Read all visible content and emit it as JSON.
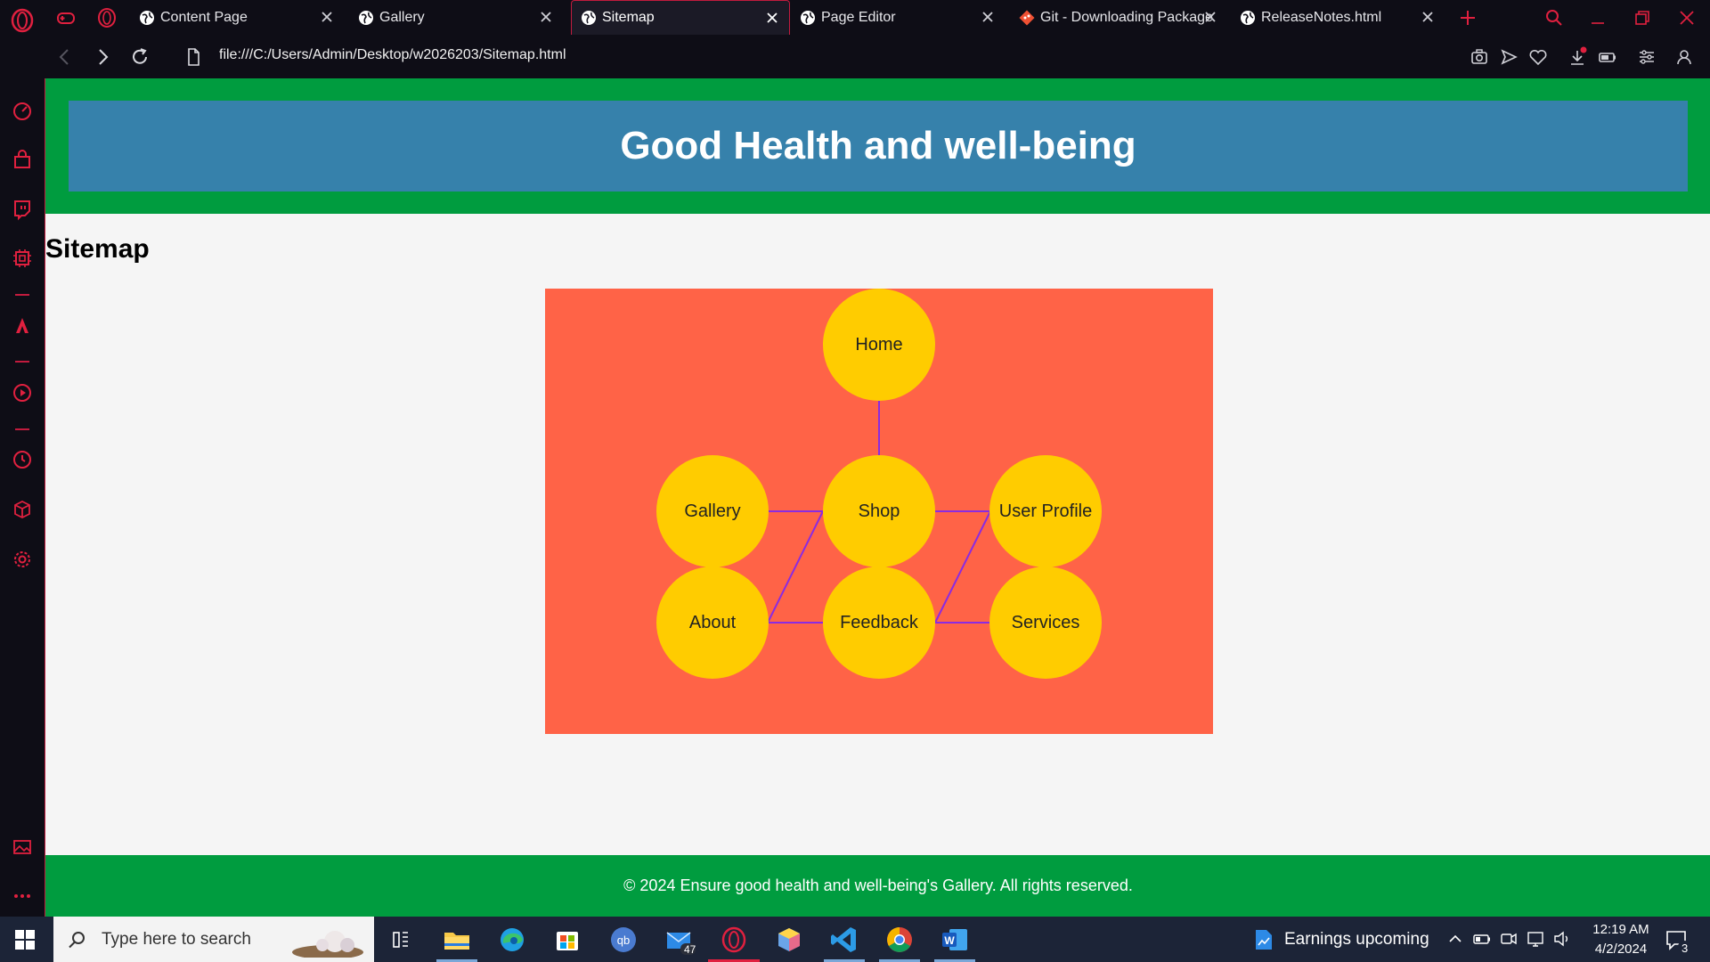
{
  "browser": {
    "tabs": [
      {
        "label": "Content Page",
        "active": false
      },
      {
        "label": "Gallery",
        "active": false
      },
      {
        "label": "Sitemap",
        "active": true
      },
      {
        "label": "Page Editor",
        "active": false
      },
      {
        "label": "Git - Downloading Package",
        "active": false
      },
      {
        "label": "ReleaseNotes.html",
        "active": false
      }
    ],
    "url": "file:///C:/Users/Admin/Desktop/w2026203/Sitemap.html",
    "accent_color": "#c21b3e"
  },
  "page": {
    "header_title": "Good Health and well-being",
    "heading": "Sitemap",
    "sitemap_nodes": {
      "home": "Home",
      "gallery": "Gallery",
      "shop": "Shop",
      "user_profile": "User Profile",
      "about": "About",
      "feedback": "Feedback",
      "services": "Services"
    },
    "footer_text": "© 2024 Ensure good health and well-being's Gallery. All rights reserved.",
    "colors": {
      "header_bg": "#009c3f",
      "title_bg": "#3681ab",
      "map_bg": "#ff6347",
      "node_bg": "#ffcc00",
      "connector": "#8a2be2"
    }
  },
  "taskbar": {
    "search_placeholder": "Type here to search",
    "news_text": "Earnings upcoming",
    "mail_badge": "47",
    "time": "12:19 AM",
    "date": "4/2/2024",
    "notification_count": "3"
  }
}
